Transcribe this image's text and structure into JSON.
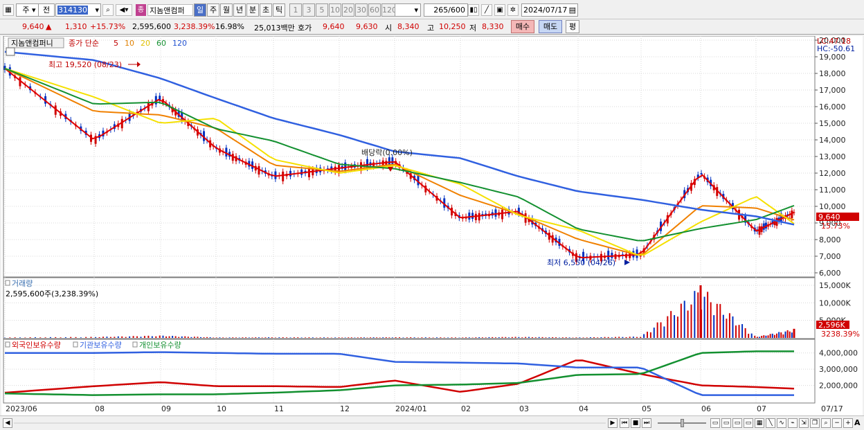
{
  "toolbar": {
    "market": "주",
    "scope": "전",
    "code": "314130",
    "badge": "종",
    "name": "지놈앤컴퍼",
    "periods": [
      "일",
      "주",
      "월",
      "년",
      "분",
      "초",
      "틱"
    ],
    "intervals": [
      "1",
      "3",
      "5",
      "10",
      "20",
      "30",
      "60",
      "120"
    ],
    "count": "265",
    "count_total": "/600",
    "date": "2024/07/17"
  },
  "quote": {
    "price": "9,640",
    "arrow": "▲",
    "change": "1,310",
    "change_pct": "+15.73%",
    "volume": "2,595,600",
    "vol_ratio": "3,238.39%",
    "turnover_pct": "16.98%",
    "amount": "25,013백만",
    "hoga_label": "호가",
    "hoga_ask": "9,640",
    "hoga_bid": "9,630",
    "open_label": "시",
    "open": "8,340",
    "high_label": "고",
    "high": "10,250",
    "low_label": "저",
    "low": "8,330",
    "buy": "매수",
    "sell": "매도",
    "flat": "평"
  },
  "price_panel": {
    "stock_label": "지놈앤컴퍼니",
    "legend_prefix": "종가 단순",
    "ma": [
      {
        "period": "5",
        "color": "#e00000"
      },
      {
        "period": "10",
        "color": "#f08000"
      },
      {
        "period": "20",
        "color": "#f5e000"
      },
      {
        "period": "60",
        "color": "#139030"
      },
      {
        "period": "120",
        "color": "#3060e0"
      }
    ],
    "lc": "LC:47.18",
    "hc": "HC:-50.61",
    "high_note": "최고 19,520 (08/23)",
    "low_note": "최저 6,550 (04/26)",
    "dividend_note": "배당락(0.00%)",
    "y_ticks": [
      "20,000",
      "19,000",
      "18,000",
      "17,000",
      "16,000",
      "15,000",
      "14,000",
      "13,000",
      "12,000",
      "11,000",
      "10,000",
      "9,000",
      "8,000",
      "7,000",
      "6,000"
    ],
    "last_price": "9,640",
    "last_pct": "15.73%"
  },
  "volume_panel": {
    "title": "거래량",
    "value": "2,595,600주(3,238.39%)",
    "y_ticks": [
      "15,000K",
      "10,000K",
      "5,000K"
    ],
    "last": "2,596K",
    "last_pct": "3238.39%"
  },
  "holding_panel": {
    "series": [
      {
        "name": "외국인보유수량",
        "color": "#d00000"
      },
      {
        "name": "기관보유수량",
        "color": "#3060e0"
      },
      {
        "name": "개인보유수량",
        "color": "#139030"
      }
    ],
    "y_ticks": [
      "4,000,000",
      "3,000,000",
      "2,000,000"
    ]
  },
  "x_axis": [
    "2023/06",
    "08",
    "09",
    "10",
    "11",
    "12",
    "2024/01",
    "02",
    "03",
    "04",
    "05",
    "06",
    "07",
    "07/17"
  ],
  "colors": {
    "up": "#d00000",
    "down": "#0030c0",
    "grid": "#d8d8d8"
  },
  "chart_data": [
    {
      "type": "line",
      "title": "지놈앤컴퍼니",
      "ylim": [
        6000,
        20000
      ],
      "x": [
        "2023/06",
        "08",
        "09",
        "10",
        "11",
        "12",
        "2024/01",
        "02",
        "03",
        "04",
        "05",
        "06",
        "07",
        "07/17"
      ],
      "series": [
        {
          "name": "5",
          "values": [
            18300,
            14000,
            16500,
            13500,
            11800,
            12300,
            12700,
            9300,
            9700,
            6900,
            7100,
            12000,
            8500,
            9640
          ]
        },
        {
          "name": "120",
          "values": [
            19300,
            18800,
            17700,
            16500,
            15300,
            14300,
            13300,
            12900,
            11800,
            10900,
            10400,
            9800,
            9400,
            8900
          ]
        }
      ]
    },
    {
      "type": "bar",
      "title": "거래량",
      "ylim": [
        0,
        15000000
      ],
      "categories": [
        "2023/06",
        "08",
        "09",
        "10",
        "11",
        "12",
        "2024/01",
        "02",
        "03",
        "04",
        "05",
        "06",
        "07",
        "07/17"
      ],
      "values": [
        150000,
        300000,
        700000,
        150000,
        200000,
        150000,
        200000,
        150000,
        300000,
        150000,
        400000,
        15000000,
        300000,
        2595600
      ]
    },
    {
      "type": "line",
      "title": "보유수량",
      "ylim": [
        1000000,
        4500000
      ],
      "x": [
        "2023/06",
        "08",
        "09",
        "10",
        "11",
        "12",
        "2024/01",
        "02",
        "03",
        "04",
        "05",
        "06",
        "07",
        "07/17"
      ],
      "series": [
        {
          "name": "외국인보유수량",
          "values": [
            1550000,
            1950000,
            2200000,
            1950000,
            1950000,
            1900000,
            2300000,
            1600000,
            2100000,
            3600000,
            2700000,
            2000000,
            1900000,
            1800000
          ]
        },
        {
          "name": "기관보유수량",
          "values": [
            4000000,
            4000000,
            4050000,
            4000000,
            3950000,
            3950000,
            3450000,
            3400000,
            3350000,
            3100000,
            3100000,
            1400000,
            1400000,
            1400000
          ]
        },
        {
          "name": "개인보유수량",
          "values": [
            1500000,
            1400000,
            1450000,
            1450000,
            1550000,
            1700000,
            2000000,
            2050000,
            2150000,
            2650000,
            2700000,
            4000000,
            4100000,
            4100000
          ]
        }
      ]
    }
  ]
}
